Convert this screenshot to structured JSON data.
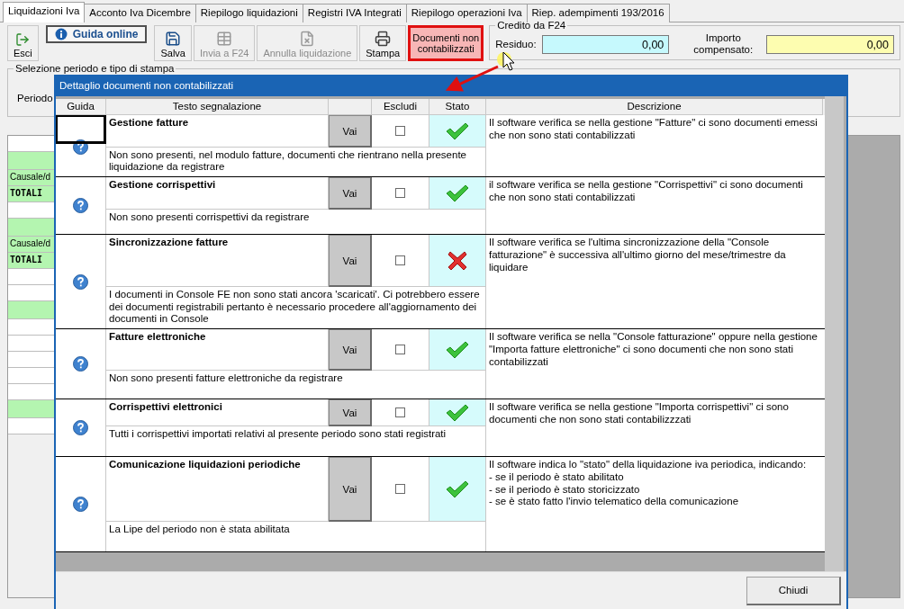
{
  "tabs": [
    {
      "label": "Liquidazioni Iva",
      "selected": true
    },
    {
      "label": "Acconto Iva Dicembre",
      "selected": false
    },
    {
      "label": "Riepilogo liquidazioni",
      "selected": false
    },
    {
      "label": "Registri IVA Integrati",
      "selected": false
    },
    {
      "label": "Riepilogo operazioni Iva",
      "selected": false
    },
    {
      "label": "Riep. adempimenti 193/2016",
      "selected": false
    }
  ],
  "guide_button": "Guida online",
  "toolbar": [
    {
      "kind": "tool",
      "label": "Esci",
      "disabled": false,
      "highlighted": false
    },
    {
      "kind": "tool",
      "label": "Salva",
      "disabled": false,
      "highlighted": false
    },
    {
      "kind": "tool",
      "label": "Invia a F24",
      "disabled": true,
      "highlighted": false
    },
    {
      "kind": "tool",
      "label": "Annulla liquidazione",
      "disabled": true,
      "highlighted": false
    },
    {
      "kind": "tool",
      "label": "Stampa",
      "disabled": false,
      "highlighted": false
    },
    {
      "kind": "text",
      "label": "Documenti non contabilizzati",
      "disabled": false,
      "highlighted": true
    }
  ],
  "credit": {
    "title": "Credito da F24",
    "fields": [
      {
        "label": "Residuo:",
        "value": "0,00"
      },
      {
        "label": "Importo compensato:",
        "value": "0,00"
      }
    ]
  },
  "selection": {
    "title": "Selezione periodo e tipo di stampa",
    "period_label": "Periodo"
  },
  "left_rows": [
    {
      "kind": "blank"
    },
    {
      "kind": "band"
    },
    {
      "kind": "label",
      "text": "Causale/d"
    },
    {
      "kind": "total",
      "text": "TOTALI"
    },
    {
      "kind": "blank"
    },
    {
      "kind": "band"
    },
    {
      "kind": "label",
      "text": "Causale/d"
    },
    {
      "kind": "total",
      "text": "TOTALI"
    },
    {
      "kind": "blank"
    },
    {
      "kind": "blank"
    },
    {
      "kind": "band"
    },
    {
      "kind": "blank"
    },
    {
      "kind": "blank"
    },
    {
      "kind": "blank"
    },
    {
      "kind": "blank"
    },
    {
      "kind": "blank"
    },
    {
      "kind": "band"
    },
    {
      "kind": "blank"
    }
  ],
  "dialog": {
    "title": "Dettaglio documenti non contabilizzati",
    "columns": {
      "guide": "Guida",
      "text": "Testo segnalazione",
      "exclude": "Escludi",
      "status": "Stato",
      "description": "Descrizione"
    },
    "rows": [
      {
        "title": "Gestione fatture",
        "message": "Non sono presenti, nel modulo fatture, documenti che rientrano nella presente liquidazione da registrare",
        "action": "Vai",
        "excluded": false,
        "passed": true,
        "focused": true,
        "description": "Il software verifica se nella gestione \"Fatture\" ci sono documenti emessi che non sono stati contabilizzati"
      },
      {
        "title": "Gestione corrispettivi",
        "message": "Non sono presenti corrispettivi da registrare",
        "action": "Vai",
        "excluded": false,
        "passed": true,
        "focused": false,
        "description": "il software verifica se nella gestione \"Corrispettivi\" ci sono documenti che non sono stati contabilizzati"
      },
      {
        "title": "Sincronizzazione fatture",
        "message": "I documenti in Console FE non sono stati ancora 'scaricati'. Ci potrebbero essere dei documenti registrabili pertanto è necessario procedere all'aggiornamento dei documenti in Console",
        "action": "Vai",
        "excluded": false,
        "passed": false,
        "focused": false,
        "description": "Il software verifica se l'ultima sincronizzazione della \"Console fatturazione\" è successiva all'ultimo giorno del mese/trimestre da liquidare"
      },
      {
        "title": "Fatture elettroniche",
        "message": "Non sono presenti fatture elettroniche da registrare",
        "action": "Vai",
        "excluded": false,
        "passed": true,
        "focused": false,
        "description": "Il software verifica se nella \"Console fatturazione\" oppure nella gestione \"Importa fatture elettroniche\" ci sono documenti che non sono stati contabilizzati"
      },
      {
        "title": "Corrispettivi elettronici",
        "message": "Tutti i corrispettivi importati relativi al presente periodo sono stati registrati",
        "action": "Vai",
        "excluded": false,
        "passed": true,
        "focused": false,
        "description": "Il software verifica se nella gestione \"Importa corrispettivi\" ci sono documenti che non sono stati contabilizzzati"
      },
      {
        "title": "Comunicazione liquidazioni periodiche",
        "message": "La Lipe del periodo non è stata abilitata",
        "action": "Vai",
        "excluded": false,
        "passed": true,
        "focused": false,
        "description": "Il software indica lo \"stato\" della liquidazione iva periodica, indicando:\n- se il periodo è stato abilitato\n- se il periodo è stato storicizzato\n- se è stato fatto l'invio telematico della comunicazione"
      }
    ],
    "close_button": "Chiudi"
  }
}
